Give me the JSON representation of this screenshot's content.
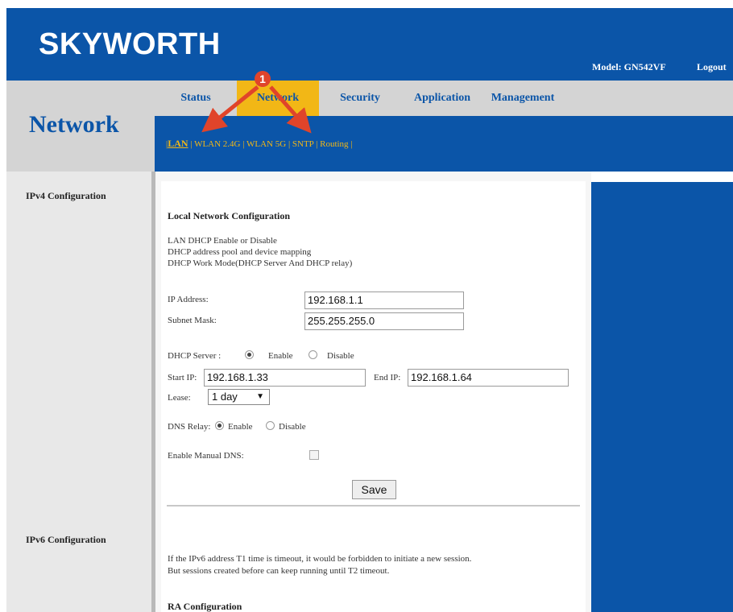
{
  "header": {
    "brand": "SKYWORTH",
    "model": "Model: GN542VF",
    "logout": "Logout"
  },
  "section_title": "Network",
  "tabs": [
    {
      "label": "Status"
    },
    {
      "label": "Network",
      "active": true
    },
    {
      "label": "Security"
    },
    {
      "label": "Application"
    },
    {
      "label": "Management"
    }
  ],
  "subnav": {
    "sep": "|",
    "items": [
      {
        "label": "LAN",
        "active": true
      },
      {
        "label": "WLAN 2.4G"
      },
      {
        "label": "WLAN 5G"
      },
      {
        "label": "SNTP"
      },
      {
        "label": "Routing"
      }
    ]
  },
  "sidebar": {
    "ipv4": "IPv4 Configuration",
    "ipv6": "IPv6 Configuration"
  },
  "lan": {
    "heading": "Local Network Configuration",
    "desc": [
      "LAN DHCP Enable or Disable",
      "DHCP address pool and device mapping",
      "DHCP Work Mode(DHCP Server And DHCP relay)"
    ],
    "ip_label": "IP Address:",
    "ip_value": "192.168.1.1",
    "mask_label": "Subnet Mask:",
    "mask_value": "255.255.255.0",
    "dhcp_label": "DHCP Server :",
    "enable": "Enable",
    "disable": "Disable",
    "start_label": "Start IP:",
    "start_value": "192.168.1.33",
    "end_label": "End IP:",
    "end_value": "192.168.1.64",
    "lease_label": "Lease:",
    "lease_value": "1 day",
    "dns_relay_label": "DNS Relay:",
    "manual_dns_label": "Enable Manual DNS:",
    "save": "Save"
  },
  "ipv6": {
    "note1": "If the IPv6 address T1 time is timeout, it would be forbidden to initiate a new session.",
    "note2": "But sessions created before can keep running until T2 timeout.",
    "ra_heading": "RA Configuration"
  },
  "annotation": {
    "number": "1",
    "color": "#e0442a"
  },
  "colors": {
    "brand_blue": "#0b55a8",
    "accent_yellow": "#f2b716"
  }
}
